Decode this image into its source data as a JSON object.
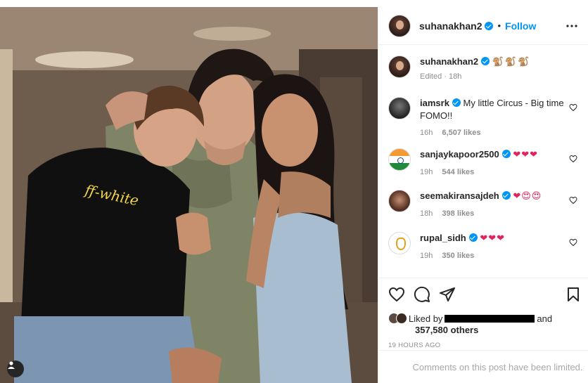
{
  "post": {
    "author": "suhanakhan2",
    "follow_label": "Follow",
    "dot": "•",
    "caption_emoji": "🐒🐒🐒",
    "caption_meta": "Edited · 18h",
    "time_ago": "19 HOURS AGO",
    "liked_by_prefix": "Liked by",
    "liked_by_suffix": "and",
    "likes_count": "357,580 others",
    "comments_limited": "Comments on this post have been limited."
  },
  "comments": [
    {
      "user": "iamsrk",
      "text": "My little Circus - Big time FOMO!!",
      "time": "16h",
      "likes": "6,507 likes",
      "verified": true
    },
    {
      "user": "sanjaykapoor2500",
      "text": "❤❤❤",
      "time": "19h",
      "likes": "544 likes",
      "verified": true
    },
    {
      "user": "seemakiransajdeh",
      "text": "❤😍😍",
      "time": "18h",
      "likes": "398 likes",
      "verified": true
    },
    {
      "user": "rupal_sidh",
      "text": "❤❤❤",
      "time": "19h",
      "likes": "350 likes",
      "verified": true
    }
  ],
  "icons": {
    "more": "more-horizontal-icon",
    "like": "heart-icon",
    "comment": "comment-bubble-icon",
    "share": "paper-plane-icon",
    "save": "bookmark-icon",
    "tag": "user-tag-icon"
  },
  "colors": {
    "accent": "#0095f6",
    "heart": "#e0245e",
    "muted": "#8e8e8e"
  }
}
